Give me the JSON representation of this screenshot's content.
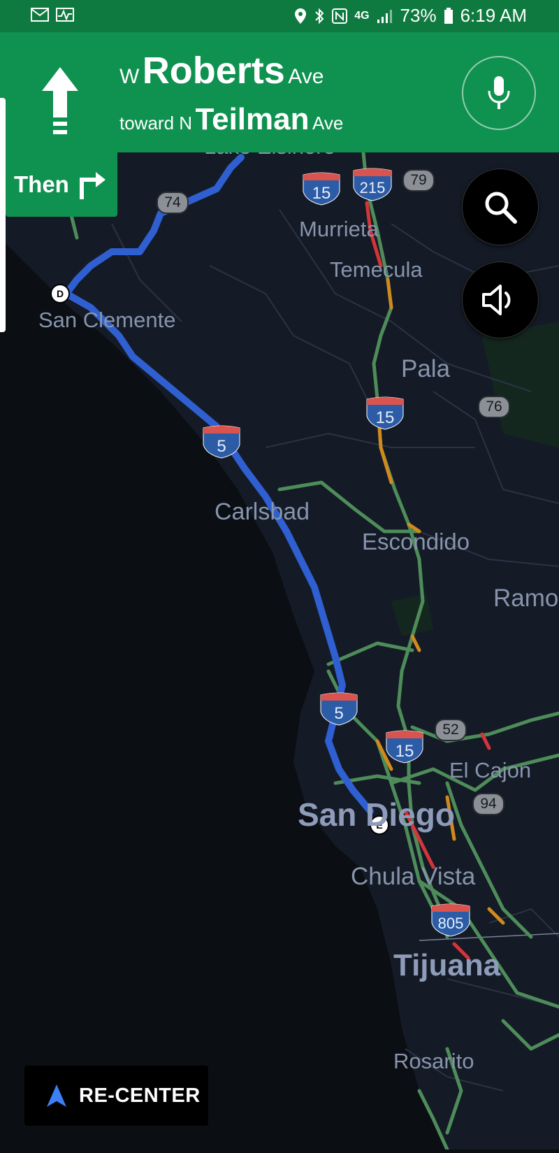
{
  "status_bar": {
    "battery": "73%",
    "time": "6:19 AM",
    "network": "4G",
    "icons": [
      "mail-icon",
      "activity-icon",
      "location-icon",
      "bluetooth-icon",
      "nfc-icon",
      "signal-icon",
      "battery-icon"
    ]
  },
  "nav": {
    "prefix": "W",
    "street": "Roberts",
    "suffix": "Ave",
    "toward_word": "toward N",
    "toward_street": "Teilman",
    "toward_suffix": "Ave",
    "then_label": "Then",
    "maneuver": "straight",
    "next_maneuver": "turn-right"
  },
  "buttons": {
    "recenter_label": "RE-CENTER",
    "search_icon": "search-icon",
    "sound_icon": "volume-icon",
    "mic_icon": "mic-icon"
  },
  "map": {
    "places": {
      "lake_elsinore": "Lake Elsinore",
      "murrieta": "Murrieta",
      "temecula": "Temecula",
      "san_clemente": "San Clemente",
      "pala": "Pala",
      "carlsbad": "Carlsbad",
      "escondido": "Escondido",
      "ramona": "Ramo",
      "el_cajon": "El Cajon",
      "san_diego": "San Diego",
      "chula_vista": "Chula Vista",
      "tijuana": "Tijuana",
      "rosarito": "Rosarito"
    },
    "interstates": {
      "i15": "15",
      "i215": "215",
      "i5": "5",
      "i805": "805"
    },
    "state_routes": {
      "r74": "74",
      "r79": "79",
      "r76": "76",
      "r52": "52",
      "r94": "94"
    },
    "markers": {
      "start": "D",
      "end": "E"
    },
    "colors": {
      "route": "#2f5fd0",
      "traffic_clear": "#4e8c5a",
      "traffic_slow": "#d08a1e",
      "traffic_heavy": "#d4343a",
      "water": "#0b0e13",
      "land": "#141b26",
      "header": "#0f9150"
    }
  }
}
